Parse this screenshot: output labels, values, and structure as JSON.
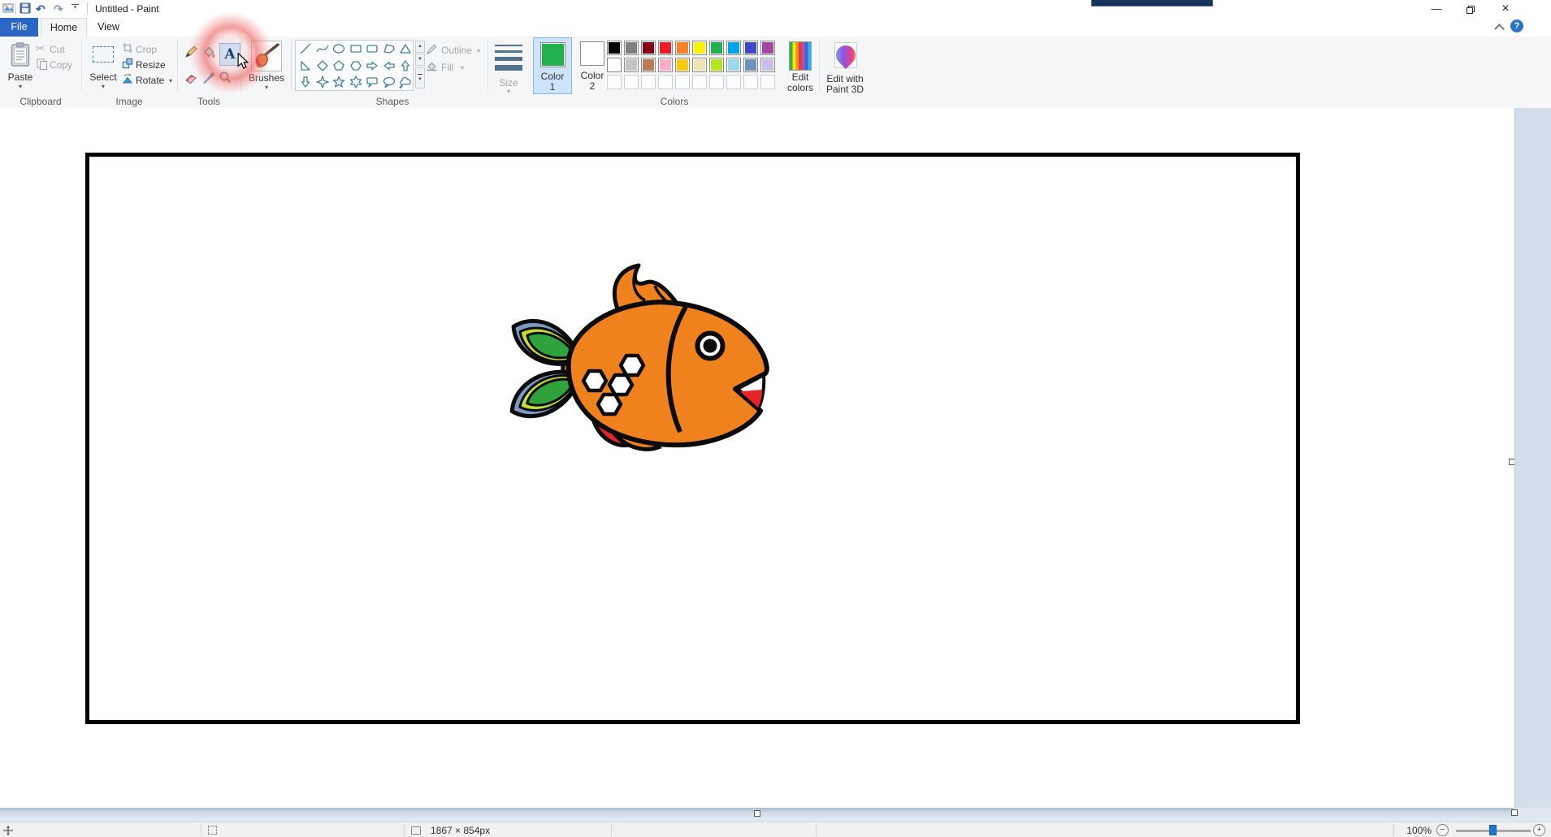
{
  "window": {
    "title": "Untitled - Paint"
  },
  "tabs": {
    "file": "File",
    "home": "Home",
    "view": "View"
  },
  "ribbon": {
    "clipboard": {
      "label": "Clipboard",
      "paste": "Paste",
      "cut": "Cut",
      "copy": "Copy"
    },
    "image": {
      "label": "Image",
      "select": "Select",
      "crop": "Crop",
      "resize": "Resize",
      "rotate": "Rotate"
    },
    "tools": {
      "label": "Tools"
    },
    "brushes": {
      "label": "Brushes"
    },
    "shapes": {
      "label": "Shapes",
      "outline": "Outline",
      "fill": "Fill",
      "items": [
        "line",
        "curve",
        "oval",
        "rectangle",
        "rounded-rectangle",
        "polygon",
        "triangle",
        "right-triangle",
        "diamond",
        "pentagon",
        "hexagon",
        "right-arrow",
        "left-arrow",
        "up-arrow",
        "down-arrow",
        "four-point-star",
        "five-point-star",
        "six-point-star",
        "rounded-callout",
        "oval-callout",
        "cloud-callout"
      ]
    },
    "size": {
      "label": "Size"
    },
    "colors": {
      "label": "Colors",
      "color1_title": "Color",
      "color1_num": "1",
      "color1_value": "#22b14c",
      "color2_title": "Color",
      "color2_num": "2",
      "color2_value": "#ffffff",
      "edit_line1": "Edit",
      "edit_line2": "colors",
      "palette_row1": [
        "#000000",
        "#7f7f7f",
        "#880015",
        "#ed1c24",
        "#ff7f27",
        "#fff200",
        "#22b14c",
        "#00a2e8",
        "#3f48cc",
        "#a349a4"
      ],
      "palette_row2": [
        "#ffffff",
        "#c3c3c3",
        "#b97a57",
        "#ffaec9",
        "#ffc90e",
        "#efe4b0",
        "#b5e61d",
        "#99d9ea",
        "#7092be",
        "#c8bfe7"
      ],
      "palette_row3_empty": 10
    },
    "paint3d": {
      "line1": "Edit with",
      "line2": "Paint 3D"
    }
  },
  "canvas": {
    "subject": "orange cartoon fish drawing inside black rectangle"
  },
  "status_bar": {
    "canvas_size": "1867 × 854px",
    "zoom": "100%"
  }
}
